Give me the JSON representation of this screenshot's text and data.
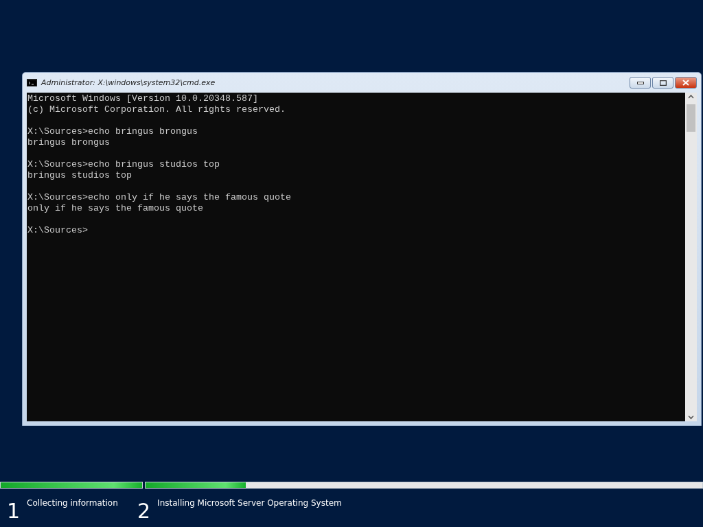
{
  "window": {
    "title": "Administrator: X:\\windows\\system32\\cmd.exe"
  },
  "console": {
    "blocks": [
      [
        "Microsoft Windows [Version 10.0.20348.587]",
        "(c) Microsoft Corporation. All rights reserved."
      ],
      [
        "X:\\Sources>echo bringus brongus",
        "bringus brongus"
      ],
      [
        "X:\\Sources>echo bringus studios top",
        "bringus studios top"
      ],
      [
        "X:\\Sources>echo only if he says the famous quote",
        "only if he says the famous quote"
      ],
      [
        "X:\\Sources>"
      ]
    ]
  },
  "steps": [
    {
      "number": "1",
      "label": "Collecting information",
      "level": 1
    },
    {
      "number": "2",
      "label": "Installing Microsoft Server Operating System",
      "level": 0.18
    }
  ]
}
